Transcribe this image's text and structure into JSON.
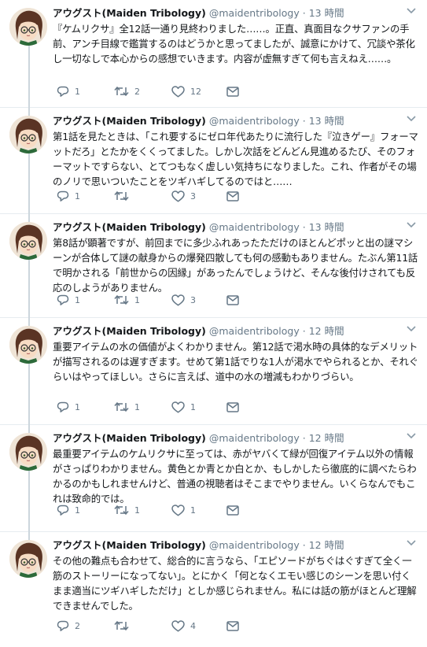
{
  "tweets": [
    {
      "name": "アウグスト(Maiden Tribology)",
      "handle": "@maidentribology",
      "dot": "·",
      "time": "13 時間",
      "text": "『ケムリクサ』全12話一通り見終わりました……。正直、真面目なクサファンの手前、アンチ目線で鑑賞するのはどうかと思ってましたが、誠意にかけて、冗談や茶化し一切なしで本心からの感想でいきます。内容が虚無すぎて何も言えねえ……。",
      "replies": "1",
      "retweets": "2",
      "likes": "12"
    },
    {
      "name": "アウグスト(Maiden Tribology)",
      "handle": "@maidentribology",
      "dot": "·",
      "time": "13 時間",
      "text": "第1話を見たときは、「これ要するにゼロ年代あたりに流行した『泣きゲー』フォーマットだろ」とたかをくくってました。しかし次話をどんどん見進めるたび、そのフォーマットですらない、とてつもなく虚しい気持ちになりました。これ、作者がその場のノリで思いついたことをツギハギしてるのではと……",
      "replies": "1",
      "retweets": "",
      "likes": "3"
    },
    {
      "name": "アウグスト(Maiden Tribology)",
      "handle": "@maidentribology",
      "dot": "·",
      "time": "13 時間",
      "text": "第8話が顕著ですが、前回までに多少ふれあったただけのほとんどポッと出の謎マシーンが合体して謎の献身からの爆発四散しても何の感動もありません。たぶん第11話で明かされる「前世からの因縁」があったんでしょうけど、そんな後付けされても反応のしようがありません。",
      "replies": "1",
      "retweets": "1",
      "likes": "3"
    },
    {
      "name": "アウグスト(Maiden Tribology)",
      "handle": "@maidentribology",
      "dot": "·",
      "time": "12 時間",
      "text": "重要アイテムの水の価値がよくわかりません。第12話で渇水時の具体的なデメリットが描写されるのは遅すぎます。せめて第1話でりな1人が渇水でやられるとか、それぐらいはやってほしい。さらに言えば、道中の水の増減もわかりづらい。",
      "replies": "1",
      "retweets": "1",
      "likes": "1"
    },
    {
      "name": "アウグスト(Maiden Tribology)",
      "handle": "@maidentribology",
      "dot": "·",
      "time": "12 時間",
      "text": "最重要アイテムのケムリクサに至っては、赤がヤバくて緑が回復アイテム以外の情報がさっぱりわかりません。黄色とか青とか白とか、もしかしたら徹底的に調べたらわかるのかもしれませんけど、普通の視聴者はそこまでやりません。いくらなんでもこれは致命的では。",
      "replies": "1",
      "retweets": "1",
      "likes": "1"
    },
    {
      "name": "アウグスト(Maiden Tribology)",
      "handle": "@maidentribology",
      "dot": "·",
      "time": "12 時間",
      "text": "その他の難点も合わせて、総合的に言うなら、「エピソードがちぐはぐすぎて全く一筋のストーリーになってない」。とにかく「何となくエモい感じのシーンを思い付くまま適当にツギハギしただけ」としか感じられません。私には話の筋がほとんど理解できませんでした。",
      "replies": "2",
      "retweets": "",
      "likes": "4"
    }
  ],
  "colors": {
    "icon": "#657786",
    "thread_line": "#ccd6dd",
    "divider": "#e6ecf0"
  }
}
